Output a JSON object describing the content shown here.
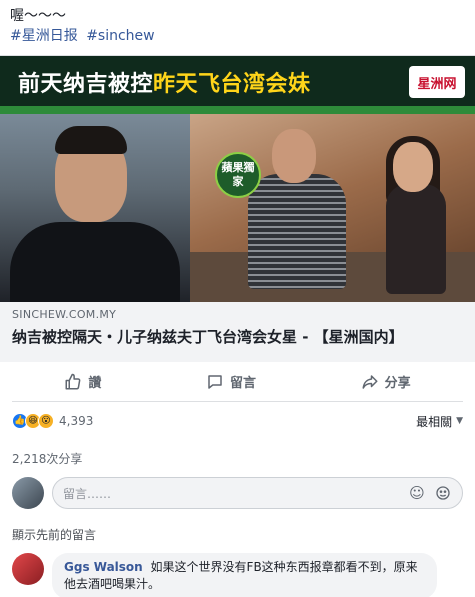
{
  "post": {
    "text": "喔～～～",
    "hashtags": [
      "#星洲日报",
      "#sinchew"
    ]
  },
  "link_card": {
    "banner_title_plain": "前天纳吉被控",
    "banner_title_highlight": "昨天飞台湾会妹",
    "brand_logo": "星洲网",
    "badge": "蘋果獨家",
    "domain": "SINCHEW.COM.MY",
    "title": "纳吉被控隔天・儿子纳兹夫丁飞台湾会女星 - 【星洲国内】"
  },
  "actions": {
    "like_label": "讚",
    "comment_label": "留言",
    "share_label": "分享"
  },
  "reactions": {
    "count": "4,393",
    "icons": [
      "like-icon",
      "haha-icon",
      "wow-icon"
    ]
  },
  "sort": {
    "label": "最相關"
  },
  "shares": {
    "text": "2,218次分享"
  },
  "comment_input": {
    "placeholder": "留言……"
  },
  "previous_comments": {
    "label": "顯示先前的留言"
  },
  "comments": [
    {
      "author": "Ggs Walson",
      "text": "如果这个世界没有FB这种东西报章都看不到，原来他去酒吧喝果汁。"
    }
  ],
  "colors": {
    "link_blue": "#365899",
    "banner_highlight": "#ffd51a",
    "banner_bg": "#0f2a1c",
    "like_blue": "#1877f2"
  }
}
